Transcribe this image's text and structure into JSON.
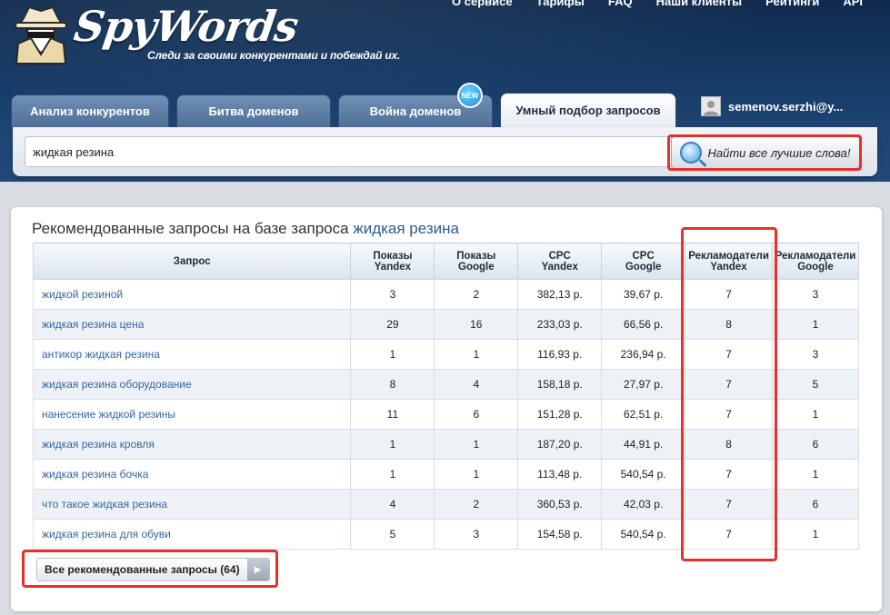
{
  "brand": {
    "name": "SpyWords",
    "slogan": "Следи за своими конкурентами и побеждай их."
  },
  "topnav": [
    "О сервисе",
    "Тарифы",
    "FAQ",
    "Наши клиенты",
    "Рейтинги",
    "API"
  ],
  "tabs": [
    {
      "label": "Анализ конкурентов"
    },
    {
      "label": "Битва доменов"
    },
    {
      "label": "Война доменов",
      "badge": "NEW"
    },
    {
      "label": "Умный подбор запросов",
      "active": true
    }
  ],
  "user": {
    "name": "semenov.serzhi@y..."
  },
  "search": {
    "value": "жидкая резина",
    "button_label": "Найти все лучшие слова!"
  },
  "results": {
    "title_prefix": "Рекомендованные запросы на базе запроса",
    "title_query": "жидкая резина",
    "headers": [
      "Запрос",
      "Показы\nYandex",
      "Показы\nGoogle",
      "CPC\nYandex",
      "CPC\nGoogle",
      "Рекламодатели\nYandex",
      "Рекламодатели\nGoogle"
    ],
    "rows": [
      [
        "жидкой резиной",
        "3",
        "2",
        "382,13 р.",
        "39,67 р.",
        "7",
        "3"
      ],
      [
        "жидкая резина цена",
        "29",
        "16",
        "233,03 р.",
        "66,56 р.",
        "8",
        "1"
      ],
      [
        "антикор жидкая резина",
        "1",
        "1",
        "116,93 р.",
        "236,94 р.",
        "7",
        "3"
      ],
      [
        "жидкая резина оборудование",
        "8",
        "4",
        "158,18 р.",
        "27,97 р.",
        "7",
        "5"
      ],
      [
        "нанесение жидкой резины",
        "11",
        "6",
        "151,28 р.",
        "62,51 р.",
        "7",
        "1"
      ],
      [
        "жидкая резина кровля",
        "1",
        "1",
        "187,20 р.",
        "44,91 р.",
        "8",
        "6"
      ],
      [
        "жидкая резина бочка",
        "1",
        "1",
        "113,48 р.",
        "540,54 р.",
        "7",
        "1"
      ],
      [
        "что такое жидкая резина",
        "4",
        "2",
        "360,53 р.",
        "42,03 р.",
        "7",
        "6"
      ],
      [
        "жидкая резина для обуви",
        "5",
        "3",
        "154,58 р.",
        "540,54 р.",
        "7",
        "1"
      ]
    ],
    "all_button_label": "Все рекомендованные запросы (64)"
  },
  "colors": {
    "highlight": "#e5302b",
    "link": "#3466a0",
    "header_bg": "#173a66"
  }
}
